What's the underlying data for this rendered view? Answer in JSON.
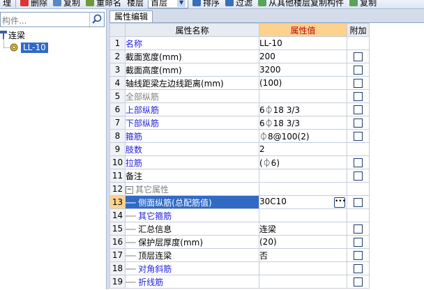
{
  "toolbar": {
    "items": [
      "理",
      "删除",
      "复制",
      "重命名",
      "楼层"
    ],
    "floor_value": "首层",
    "sort_label": "排序",
    "filter_label": "过滤",
    "copy_from_label": "从其他楼层复制构件",
    "copy_label": "复制"
  },
  "sidebar": {
    "search_placeholder": "构件...",
    "root_label": "连梁",
    "selected_item": "LL-10"
  },
  "editor": {
    "tab_label": "属性编辑",
    "col_name": "属性名称",
    "col_value": "属性值",
    "col_add": "附加",
    "rows": [
      {
        "num": "1",
        "name": "名称",
        "value": "LL-10",
        "style": "blue",
        "checkbox": false
      },
      {
        "num": "2",
        "name": "截面宽度(mm)",
        "value": "200",
        "style": "black",
        "checkbox": true
      },
      {
        "num": "3",
        "name": "截面高度(mm)",
        "value": "3200",
        "style": "black",
        "checkbox": true
      },
      {
        "num": "4",
        "name": "轴线距梁左边线距离(mm)",
        "value": "(100)",
        "style": "black",
        "checkbox": true
      },
      {
        "num": "5",
        "name": "全部纵筋",
        "value": "",
        "style": "gray",
        "checkbox": true
      },
      {
        "num": "6",
        "name": "上部纵筋",
        "value": "6⏀18 3/3",
        "style": "blue",
        "checkbox": true
      },
      {
        "num": "7",
        "name": "下部纵筋",
        "value": "6⏀18 3/3",
        "style": "blue",
        "checkbox": true
      },
      {
        "num": "8",
        "name": "箍筋",
        "value": "⏀8@100(2)",
        "style": "blue",
        "checkbox": true
      },
      {
        "num": "9",
        "name": "肢数",
        "value": "2",
        "style": "blue",
        "checkbox": false
      },
      {
        "num": "10",
        "name": "拉筋",
        "value": "(⏀6)",
        "style": "blue",
        "checkbox": true
      },
      {
        "num": "11",
        "name": "备注",
        "value": "",
        "style": "black",
        "checkbox": true
      },
      {
        "num": "12",
        "name": "其它属性",
        "value": "",
        "style": "group",
        "checkbox": false
      },
      {
        "num": "13",
        "name": "侧面纵筋(总配筋值)",
        "value": "30C10",
        "style": "selected",
        "checkbox": true
      },
      {
        "num": "14",
        "name": "其它箍筋",
        "value": "",
        "style": "blue-child",
        "checkbox": false
      },
      {
        "num": "15",
        "name": "汇总信息",
        "value": "连梁",
        "style": "child",
        "checkbox": true
      },
      {
        "num": "16",
        "name": "保护层厚度(mm)",
        "value": "(20)",
        "style": "child",
        "checkbox": true
      },
      {
        "num": "17",
        "name": "顶层连梁",
        "value": "否",
        "style": "child",
        "checkbox": true
      },
      {
        "num": "18",
        "name": "对角斜筋",
        "value": "",
        "style": "blue-child",
        "checkbox": true
      },
      {
        "num": "19",
        "name": "折线筋",
        "value": "",
        "style": "blue-child",
        "checkbox": true
      }
    ]
  },
  "colors": {
    "header_value_bg": "#fcd28d",
    "header_value_text": "#c00000",
    "selection": "#316ac5",
    "blue_text": "#1f1fd8",
    "gray_text": "#808080"
  }
}
